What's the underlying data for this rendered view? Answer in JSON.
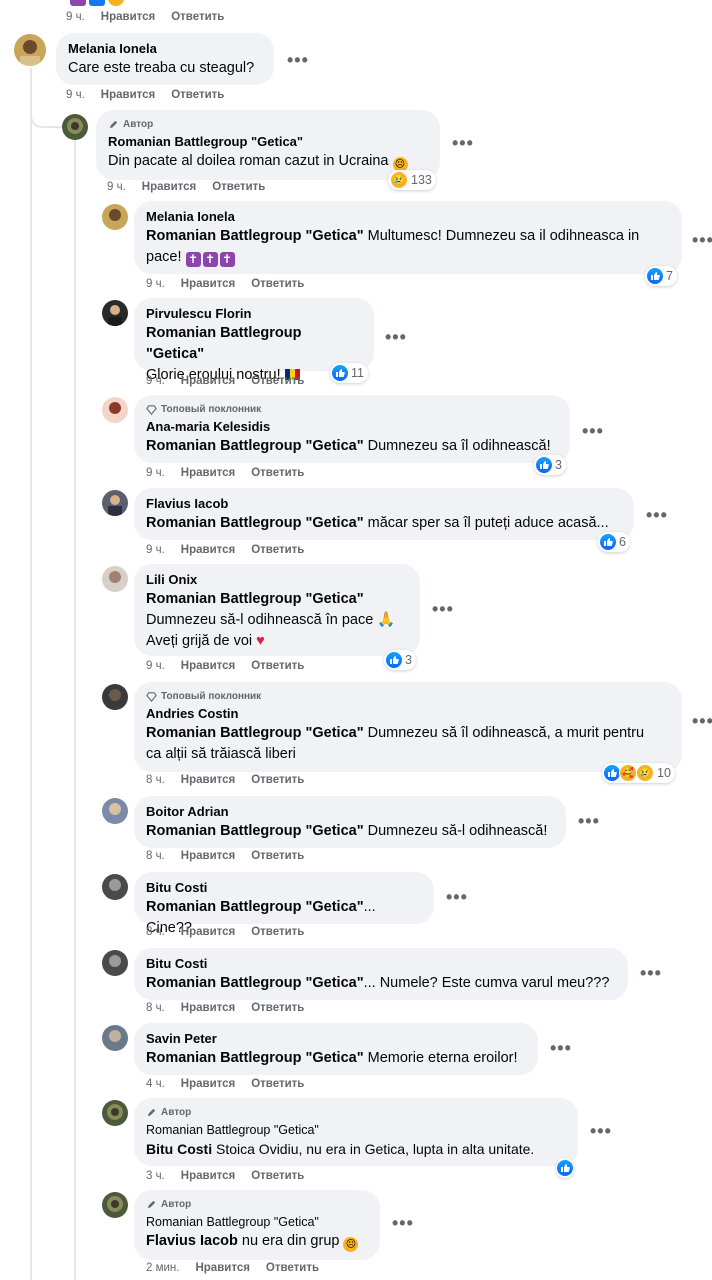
{
  "top_meta": {
    "time": "9 ч.",
    "like": "Нравится",
    "reply": "Ответить"
  },
  "labels": {
    "author_badge": "Автор",
    "top_fan": "Топовый поклонник",
    "like": "Нравится",
    "reply": "Ответить",
    "more": "•••"
  },
  "comments": [
    {
      "author": "Melania Ionela",
      "text": "Care este treaba cu steagul?",
      "time": "9 ч."
    },
    {
      "author": "Romanian Battlegroup \"Getica\"",
      "text": "Din pacate al doilea roman cazut in Ucraina",
      "time": "9 ч.",
      "reaction_count": "133"
    },
    {
      "author": "Melania Ionela",
      "mention": "Romanian Battlegroup \"Getica\"",
      "text": " Multumesc! Dumnezeu sa il odihneasca in",
      "text2": "pace!",
      "time": "9 ч.",
      "reaction_count": "7"
    },
    {
      "author": "Pirvulescu Florin",
      "mention": "Romanian Battlegroup \"Getica\"",
      "text": "Glorie eroului nostru!",
      "time": "9 ч.",
      "reaction_count": "11"
    },
    {
      "author": "Ana-maria Kelesidis",
      "mention": "Romanian Battlegroup \"Getica\"",
      "text": " Dumnezeu sa îl odihnească!",
      "time": "9 ч.",
      "reaction_count": "3"
    },
    {
      "author": "Flavius Iacob",
      "mention": "Romanian Battlegroup \"Getica\"",
      "text": " măcar sper sa îl puteți aduce acasă...",
      "time": "9 ч.",
      "reaction_count": "6"
    },
    {
      "author": "Lili Onix",
      "mention": "Romanian Battlegroup \"Getica\"",
      "text": "Dumnezeu să-l odihnească în pace",
      "text2": "Aveți grijă de voi",
      "time": "9 ч.",
      "reaction_count": "3"
    },
    {
      "author": "Andries Costin",
      "mention": "Romanian Battlegroup \"Getica\"",
      "text": " Dumnezeu să îl odihnească, a murit pentru",
      "text2": "ca alții să trăiască liberi",
      "time": "8 ч.",
      "reaction_count": "10"
    },
    {
      "author": "Boitor Adrian",
      "mention": "Romanian Battlegroup \"Getica\"",
      "text": " Dumnezeu să-l odihnească!",
      "time": "8 ч."
    },
    {
      "author": "Bitu Costi",
      "mention": "Romanian Battlegroup \"Getica\"",
      "text": "... Cine??",
      "time": "8 ч."
    },
    {
      "author": "Bitu Costi",
      "mention": "Romanian Battlegroup \"Getica\"",
      "text": "... Numele? Este cumva varul meu???",
      "time": "8 ч."
    },
    {
      "author": "Savin Peter",
      "mention": "Romanian Battlegroup \"Getica\"",
      "text": " Memorie eterna eroilor!",
      "time": "4 ч."
    },
    {
      "author": "Romanian Battlegroup \"Getica\"",
      "mention": "Bitu Costi",
      "text": " Stoica Ovidiu, nu era in Getica, lupta in alta unitate.",
      "time": "3 ч."
    },
    {
      "author": "Romanian Battlegroup \"Getica\"",
      "mention": "Flavius Iacob",
      "text": " nu era din grup",
      "time": "2 мин."
    }
  ],
  "colors": {
    "bubble": "#f0f2f5",
    "like_blue": "#0866ff",
    "meta_gray": "#65676b",
    "thread_line": "#e4e6eb"
  }
}
